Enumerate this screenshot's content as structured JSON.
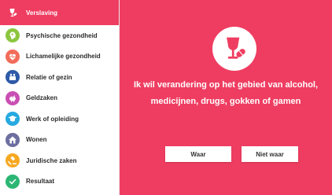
{
  "sidebar": {
    "items": [
      {
        "label": "Verslaving",
        "icon": "wine-glass-pill-icon",
        "color": "#ef3d61",
        "active": true
      },
      {
        "label": "Psychische gezondheid",
        "icon": "head-brain-icon",
        "color": "#8cc63f"
      },
      {
        "label": "Lichamelijke gezondheid",
        "icon": "heartbeat-icon",
        "color": "#f26c5a"
      },
      {
        "label": "Relatie of gezin",
        "icon": "family-icon",
        "color": "#2e5aa8"
      },
      {
        "label": "Geldzaken",
        "icon": "piggy-bank-icon",
        "color": "#c94fb3"
      },
      {
        "label": "Werk of opleiding",
        "icon": "graduation-cap-icon",
        "color": "#26a9e0"
      },
      {
        "label": "Wonen",
        "icon": "house-icon",
        "color": "#6d6e9f"
      },
      {
        "label": "Juridische zaken",
        "icon": "gavel-icon",
        "color": "#f7a823"
      },
      {
        "label": "Resultaat",
        "icon": "checkmark-icon",
        "color": "#2bb673"
      }
    ]
  },
  "main": {
    "background": "#ef3d61",
    "hero_icon": "wine-glass-pill-icon",
    "question": "Ik wil verandering op het gebied van alcohol, medicijnen, drugs, gokken of gamen",
    "buttons": {
      "true_label": "Waar",
      "false_label": "Niet waar"
    }
  }
}
